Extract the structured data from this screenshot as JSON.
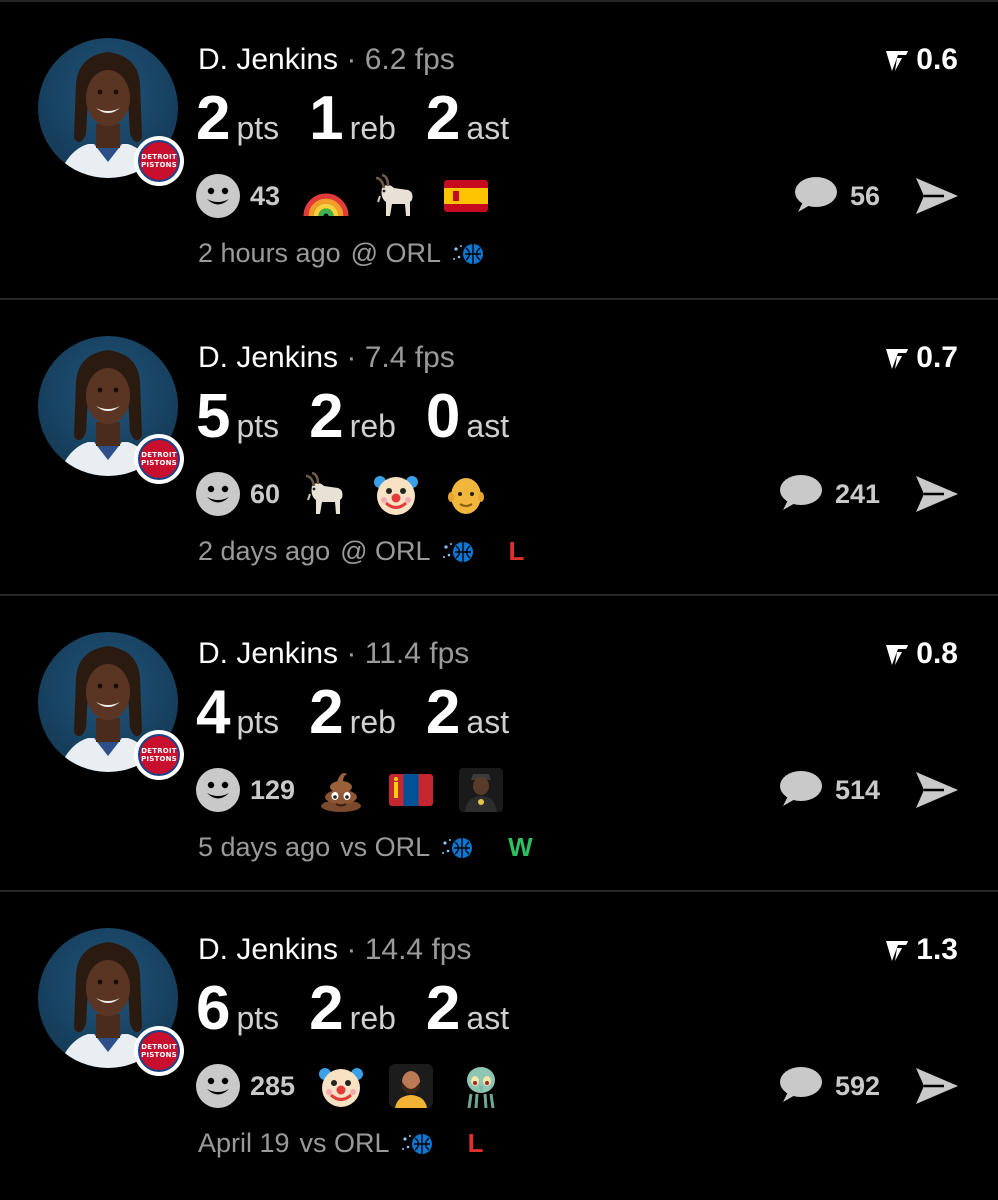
{
  "colors": {
    "background": "#000000",
    "divider": "#262626",
    "muted_text": "#9a9a9a",
    "loss": "#e0302c",
    "win": "#2fbf62"
  },
  "cards": [
    {
      "player": "D. Jenkins",
      "fps": "· 6.2 fps",
      "rating": "0.6",
      "stats": [
        {
          "value": "2",
          "unit": "pts"
        },
        {
          "value": "1",
          "unit": "reb"
        },
        {
          "value": "2",
          "unit": "ast"
        }
      ],
      "reaction_count": "43",
      "emojis": [
        "rainbow-emoji",
        "goat-emoji",
        "spain-flag-emoji"
      ],
      "comment_count": "56",
      "time": "2 hours ago",
      "matchup": "@ ORL",
      "result": ""
    },
    {
      "player": "D. Jenkins",
      "fps": "· 7.4 fps",
      "rating": "0.7",
      "stats": [
        {
          "value": "5",
          "unit": "pts"
        },
        {
          "value": "2",
          "unit": "reb"
        },
        {
          "value": "0",
          "unit": "ast"
        }
      ],
      "reaction_count": "60",
      "emojis": [
        "goat-emoji",
        "clown-emoji",
        "bald-man-emoji"
      ],
      "comment_count": "241",
      "time": "2 days ago",
      "matchup": "@ ORL",
      "result": "L"
    },
    {
      "player": "D. Jenkins",
      "fps": "· 11.4 fps",
      "rating": "0.8",
      "stats": [
        {
          "value": "4",
          "unit": "pts"
        },
        {
          "value": "2",
          "unit": "reb"
        },
        {
          "value": "2",
          "unit": "ast"
        }
      ],
      "reaction_count": "129",
      "emojis": [
        "poop-emoji",
        "mongolia-flag-emoji",
        "person-photo-emoji"
      ],
      "comment_count": "514",
      "time": "5 days ago",
      "matchup": "vs ORL",
      "result": "W"
    },
    {
      "player": "D. Jenkins",
      "fps": "· 14.4 fps",
      "rating": "1.3",
      "stats": [
        {
          "value": "6",
          "unit": "pts"
        },
        {
          "value": "2",
          "unit": "reb"
        },
        {
          "value": "2",
          "unit": "ast"
        }
      ],
      "reaction_count": "285",
      "emojis": [
        "clown-emoji",
        "player-photo-emoji",
        "squidward-emoji"
      ],
      "comment_count": "592",
      "time": "April 19",
      "matchup": "vs ORL",
      "result": "L"
    }
  ],
  "team_badge": {
    "line1": "DETROIT",
    "line2": "PISTONS"
  }
}
